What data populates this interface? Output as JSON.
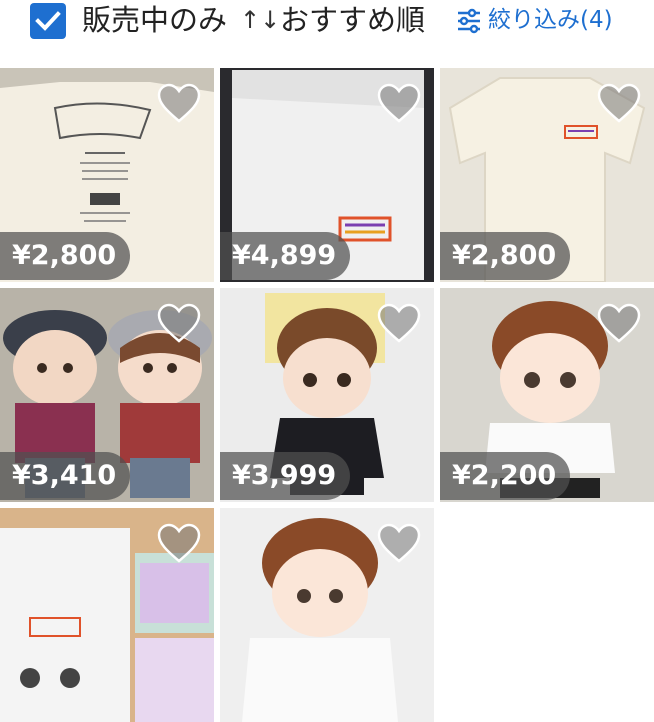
{
  "filters": {
    "on_sale_checked": true,
    "on_sale_label": "販売中のみ",
    "sort_icon": "↑↓",
    "sort_label": "おすすめ順",
    "filter_label": "絞り込み(4)"
  },
  "items": [
    {
      "price": "¥2,800",
      "icon": "heart-icon"
    },
    {
      "price": "¥4,899",
      "icon": "heart-icon"
    },
    {
      "price": "¥2,800",
      "icon": "heart-icon"
    },
    {
      "price": "¥3,410",
      "icon": "heart-icon"
    },
    {
      "price": "¥3,999",
      "icon": "heart-icon"
    },
    {
      "price": "¥2,200",
      "icon": "heart-icon"
    },
    {
      "price": "",
      "icon": "heart-icon"
    },
    {
      "price": "",
      "icon": "heart-icon"
    }
  ],
  "colors": {
    "accent": "#1e6fd0",
    "price_bg": "#505050"
  }
}
